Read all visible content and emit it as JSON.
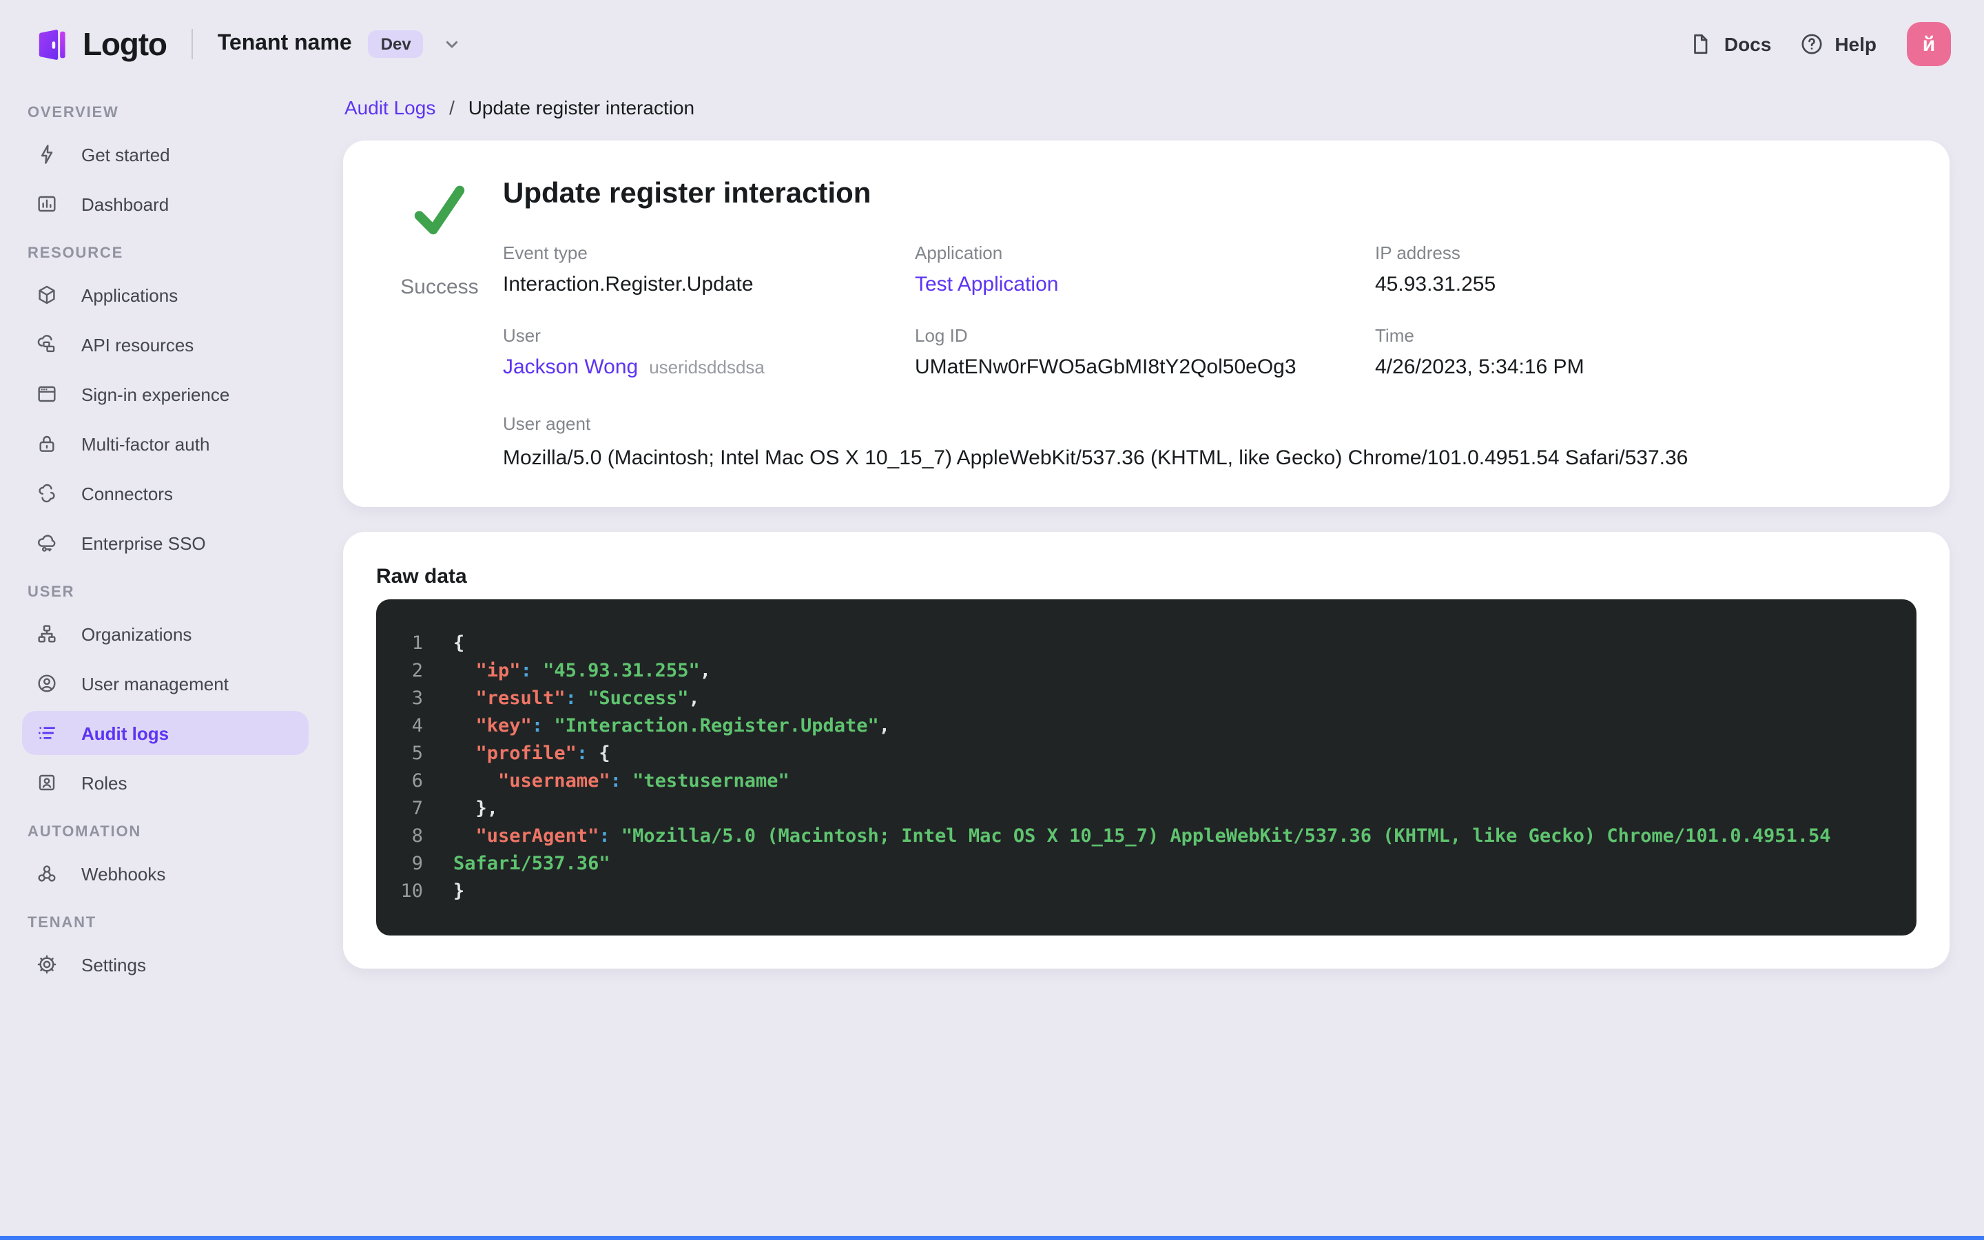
{
  "header": {
    "brand": "Logto",
    "tenant_name": "Tenant name",
    "tenant_badge": "Dev",
    "docs_label": "Docs",
    "help_label": "Help",
    "avatar_letter": "й"
  },
  "sidebar": {
    "sections": [
      {
        "label": "OVERVIEW",
        "items": [
          {
            "icon": "lightning-icon",
            "label": "Get started"
          },
          {
            "icon": "dashboard-icon",
            "label": "Dashboard"
          }
        ]
      },
      {
        "label": "RESOURCE",
        "items": [
          {
            "icon": "cube-icon",
            "label": "Applications"
          },
          {
            "icon": "cloud-stack-icon",
            "label": "API resources"
          },
          {
            "icon": "browser-icon",
            "label": "Sign-in experience"
          },
          {
            "icon": "lock-icon",
            "label": "Multi-factor auth"
          },
          {
            "icon": "clouds-icon",
            "label": "Connectors"
          },
          {
            "icon": "cloud-key-icon",
            "label": "Enterprise SSO"
          }
        ]
      },
      {
        "label": "USER",
        "items": [
          {
            "icon": "org-chart-icon",
            "label": "Organizations"
          },
          {
            "icon": "user-circle-icon",
            "label": "User management"
          },
          {
            "icon": "audit-list-icon",
            "label": "Audit logs",
            "active": true
          },
          {
            "icon": "id-badge-icon",
            "label": "Roles"
          }
        ]
      },
      {
        "label": "AUTOMATION",
        "items": [
          {
            "icon": "webhook-icon",
            "label": "Webhooks"
          }
        ]
      },
      {
        "label": "TENANT",
        "items": [
          {
            "icon": "gear-icon",
            "label": "Settings"
          }
        ]
      }
    ]
  },
  "breadcrumb": {
    "parent": "Audit Logs",
    "separator": "/",
    "current": "Update register interaction"
  },
  "detail_card": {
    "title": "Update register interaction",
    "status": "Success",
    "fields": [
      {
        "label": "Event type",
        "value": "Interaction.Register.Update"
      },
      {
        "label": "Application",
        "value": "Test Application"
      },
      {
        "label": "IP address",
        "value": "45.93.31.255"
      },
      {
        "label": "User",
        "value": "Jackson Wong",
        "suffix": "useridsddsdsa"
      },
      {
        "label": "Log ID",
        "value": "UMatENw0rFWO5aGbMI8tY2Qol50eOg3"
      },
      {
        "label": "Time",
        "value": "4/26/2023, 5:34:16 PM"
      },
      {
        "label": "User agent",
        "value": "Mozilla/5.0 (Macintosh; Intel Mac OS X 10_15_7) AppleWebKit/537.36 (KHTML, like Gecko) Chrome/101.0.4951.54 Safari/537.36"
      }
    ]
  },
  "raw_data_card": {
    "title": "Raw data",
    "lines": [
      {
        "n": "1",
        "tokens": [
          [
            "p",
            "{"
          ]
        ]
      },
      {
        "n": "2",
        "tokens": [
          [
            "p",
            "  "
          ],
          [
            "k",
            "\"ip\""
          ],
          [
            "c",
            ":"
          ],
          [
            "p",
            " "
          ],
          [
            "s",
            "\"45.93.31.255\""
          ],
          [
            "p",
            ","
          ]
        ]
      },
      {
        "n": "3",
        "tokens": [
          [
            "p",
            "  "
          ],
          [
            "k",
            "\"result\""
          ],
          [
            "c",
            ":"
          ],
          [
            "p",
            " "
          ],
          [
            "s",
            "\"Success\""
          ],
          [
            "p",
            ","
          ]
        ]
      },
      {
        "n": "4",
        "tokens": [
          [
            "p",
            "  "
          ],
          [
            "k",
            "\"key\""
          ],
          [
            "c",
            ":"
          ],
          [
            "p",
            " "
          ],
          [
            "s",
            "\"Interaction.Register.Update\""
          ],
          [
            "p",
            ","
          ]
        ]
      },
      {
        "n": "5",
        "tokens": [
          [
            "p",
            "  "
          ],
          [
            "k",
            "\"profile\""
          ],
          [
            "c",
            ":"
          ],
          [
            "p",
            " {"
          ]
        ]
      },
      {
        "n": "6",
        "tokens": [
          [
            "p",
            "    "
          ],
          [
            "k",
            "\"username\""
          ],
          [
            "c",
            ":"
          ],
          [
            "p",
            " "
          ],
          [
            "s",
            "\"testusername\""
          ]
        ]
      },
      {
        "n": "7",
        "tokens": [
          [
            "p",
            "  },"
          ]
        ]
      },
      {
        "n": "8",
        "tokens": [
          [
            "p",
            "  "
          ],
          [
            "k",
            "\"userAgent\""
          ],
          [
            "c",
            ":"
          ],
          [
            "p",
            " "
          ],
          [
            "s",
            "\"Mozilla/5.0 (Macintosh; Intel Mac OS X 10_15_7) AppleWebKit/537.36 (KHTML, like Gecko) Chrome/101.0.4951.54"
          ]
        ]
      },
      {
        "n": "9",
        "tokens": [
          [
            "s",
            "Safari/537.36\""
          ]
        ]
      },
      {
        "n": "10",
        "tokens": [
          [
            "p",
            "}"
          ]
        ]
      }
    ]
  },
  "colors": {
    "accent": "#5d34f2",
    "accent_bg": "#ddd6f8",
    "page_bg": "#eae9f2",
    "success_green": "#3fa34d",
    "avatar_pink": "#ec6e96",
    "code_bg": "#202425",
    "code_key": "#ef7565",
    "code_string": "#5fc46f",
    "code_colon": "#4da6dc",
    "code_punct": "#e3e5e7",
    "code_line_number": "#9a9da0",
    "bottom_strip": "#3a7af8"
  }
}
